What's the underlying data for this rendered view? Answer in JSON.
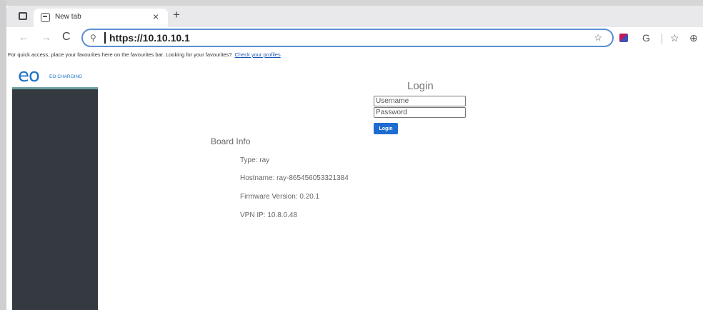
{
  "browser": {
    "tab_title": "New tab",
    "tab_close": "×",
    "new_tab": "+",
    "url": "https://10.10.10.1",
    "favourites_bar_text": "For quick access, place your favourites here on the favourites bar. Looking for your favourites?",
    "favourites_bar_link": "Check your profiles",
    "icons": {
      "back": "←",
      "forward": "→",
      "reload": "C",
      "search": "⚲",
      "favorite_add": "☆",
      "refresh": "G",
      "favorites": "☆",
      "extensions": "⊕"
    }
  },
  "sidebar": {
    "logo": "eo",
    "brand": "EO CHARGING"
  },
  "login": {
    "title": "Login",
    "username_placeholder": "Username",
    "password_placeholder": "Password",
    "button_label": "Login"
  },
  "board_info": {
    "title": "Board Info",
    "type": "Type: ray",
    "hostname": "Hostname: ray-865456053321384",
    "firmware": "Firmware Version: 0.20.1",
    "vpn_ip": "VPN IP: 10.8.0.48"
  },
  "colors": {
    "accent": "#1e6ccf",
    "sidebar": "#343a40",
    "brand": "#1e73c8"
  }
}
